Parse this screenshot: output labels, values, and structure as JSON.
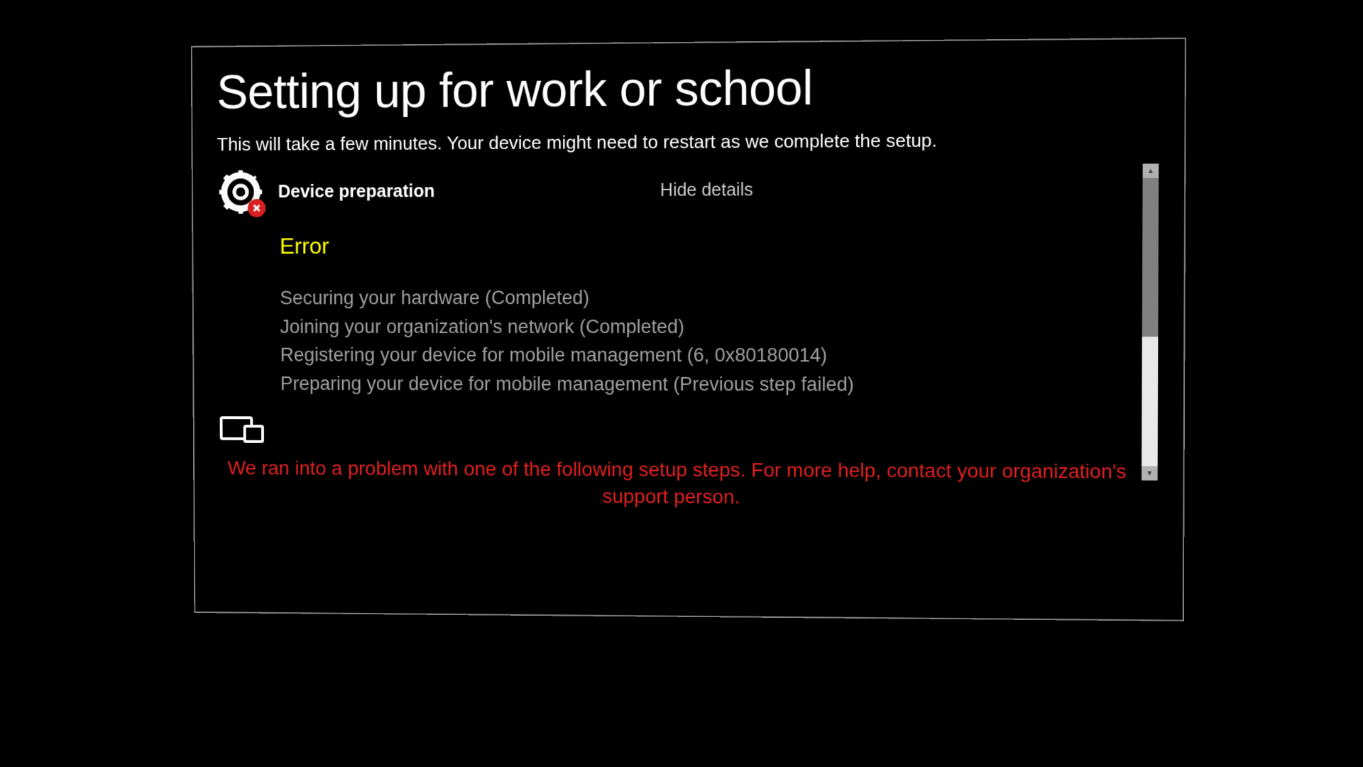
{
  "dialog": {
    "title": "Setting up for work or school",
    "subtitle": "This will take a few minutes. Your device might need to restart as we complete the setup."
  },
  "section": {
    "label": "Device preparation",
    "toggle_label": "Hide details",
    "status": "Error",
    "steps": [
      "Securing your hardware (Completed)",
      "Joining your organization's network (Completed)",
      "Registering your device for mobile management (6, 0x80180014)",
      "Preparing your device for mobile management (Previous step failed)"
    ]
  },
  "footer": {
    "problem_message": "We ran into a problem with one of the following setup steps. For more help, contact your organization's support person."
  },
  "colors": {
    "error_status": "#ffff00",
    "error_message": "#e02020",
    "badge": "#d92020"
  }
}
